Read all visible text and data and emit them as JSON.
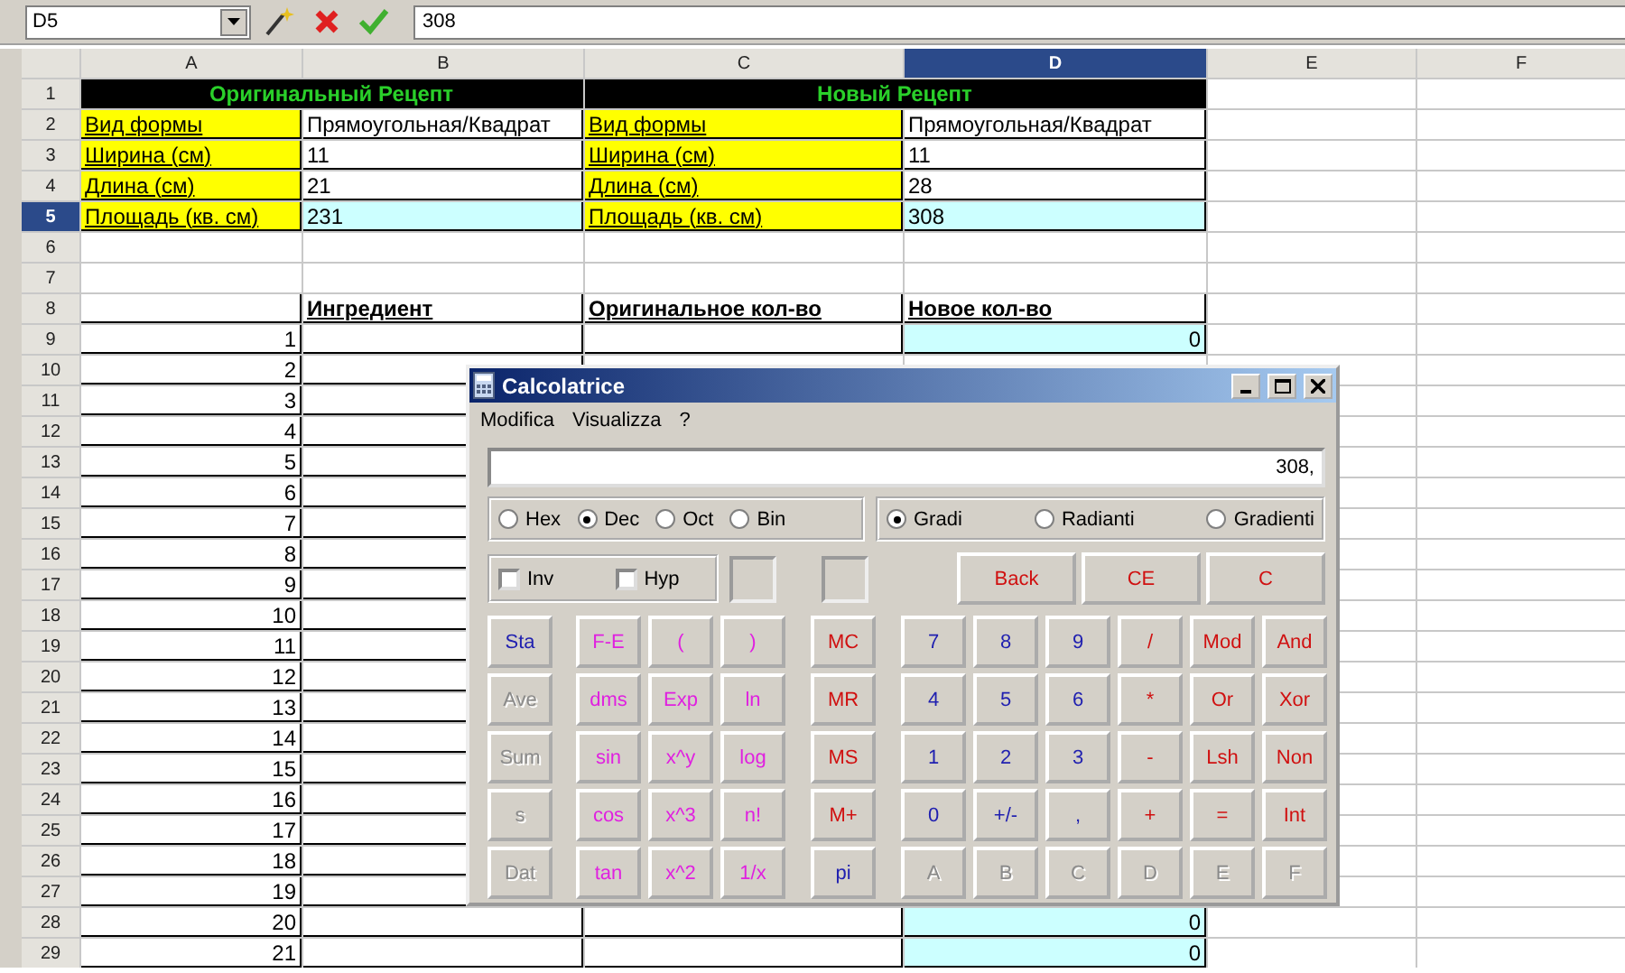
{
  "formula_bar": {
    "cell_reference": "D5",
    "value": "308"
  },
  "sheet": {
    "columns": [
      {
        "label": "A",
        "selected": false
      },
      {
        "label": "B",
        "selected": false
      },
      {
        "label": "C",
        "selected": false
      },
      {
        "label": "D",
        "selected": true
      },
      {
        "label": "E",
        "selected": false
      },
      {
        "label": "F",
        "selected": false
      }
    ],
    "rows": [
      {
        "number": "1",
        "selected": false,
        "cells": [
          {
            "text": "Оригинальный Рецепт",
            "kind": "title"
          },
          {
            "text": "Новый Рецепт",
            "kind": "title"
          }
        ]
      },
      {
        "number": "2",
        "selected": false,
        "cells": [
          {
            "text": "Вид формы",
            "kind": "label"
          },
          {
            "text": "Прямоугольная/Квадрат",
            "kind": "text"
          },
          {
            "text": "Вид формы",
            "kind": "label"
          },
          {
            "text": "Прямоугольная/Квадрат",
            "kind": "text"
          }
        ]
      },
      {
        "number": "3",
        "selected": false,
        "cells": [
          {
            "text": "Ширина (см)",
            "kind": "label"
          },
          {
            "text": "11",
            "kind": "text"
          },
          {
            "text": "Ширина (см)",
            "kind": "label"
          },
          {
            "text": "11",
            "kind": "text"
          }
        ]
      },
      {
        "number": "4",
        "selected": false,
        "cells": [
          {
            "text": "Длина (см)",
            "kind": "label"
          },
          {
            "text": "21",
            "kind": "text"
          },
          {
            "text": "Длина (см)",
            "kind": "label"
          },
          {
            "text": "28",
            "kind": "text"
          }
        ]
      },
      {
        "number": "5",
        "selected": true,
        "cells": [
          {
            "text": "Площадь (кв. см)",
            "kind": "label"
          },
          {
            "text": "231",
            "kind": "result"
          },
          {
            "text": "Площадь (кв. см)",
            "kind": "label"
          },
          {
            "text": "308",
            "kind": "result"
          }
        ]
      },
      {
        "number": "6",
        "selected": false
      },
      {
        "number": "7",
        "selected": false
      },
      {
        "number": "8",
        "selected": false,
        "cells": [
          {
            "kind": "cell"
          },
          {
            "text": "Ингредиент",
            "kind": "heading"
          },
          {
            "text": "Оригинальное кол-во",
            "kind": "heading"
          },
          {
            "text": "Новое кол-во",
            "kind": "heading"
          }
        ]
      },
      {
        "number": "9",
        "selected": false,
        "cells": [
          {
            "text": "1",
            "kind": "number"
          },
          {
            "kind": "cell"
          },
          {
            "kind": "cell"
          },
          {
            "text": "0",
            "kind": "result-number"
          }
        ]
      },
      {
        "number": "10",
        "selected": false,
        "cells": [
          {
            "text": "2",
            "kind": "number"
          },
          {
            "kind": "cell"
          }
        ]
      },
      {
        "number": "11",
        "selected": false,
        "cells": [
          {
            "text": "3",
            "kind": "number"
          },
          {
            "kind": "cell"
          }
        ]
      },
      {
        "number": "12",
        "selected": false,
        "cells": [
          {
            "text": "4",
            "kind": "number"
          },
          {
            "kind": "cell"
          }
        ]
      },
      {
        "number": "13",
        "selected": false,
        "cells": [
          {
            "text": "5",
            "kind": "number"
          },
          {
            "kind": "cell"
          }
        ]
      },
      {
        "number": "14",
        "selected": false,
        "cells": [
          {
            "text": "6",
            "kind": "number"
          },
          {
            "kind": "cell"
          }
        ]
      },
      {
        "number": "15",
        "selected": false,
        "cells": [
          {
            "text": "7",
            "kind": "number"
          },
          {
            "kind": "cell"
          }
        ]
      },
      {
        "number": "16",
        "selected": false,
        "cells": [
          {
            "text": "8",
            "kind": "number"
          },
          {
            "kind": "cell"
          }
        ]
      },
      {
        "number": "17",
        "selected": false,
        "cells": [
          {
            "text": "9",
            "kind": "number"
          },
          {
            "kind": "cell"
          }
        ]
      },
      {
        "number": "18",
        "selected": false,
        "cells": [
          {
            "text": "10",
            "kind": "number"
          },
          {
            "kind": "cell"
          }
        ]
      },
      {
        "number": "19",
        "selected": false,
        "cells": [
          {
            "text": "11",
            "kind": "number"
          },
          {
            "kind": "cell"
          }
        ]
      },
      {
        "number": "20",
        "selected": false,
        "cells": [
          {
            "text": "12",
            "kind": "number"
          },
          {
            "kind": "cell"
          }
        ]
      },
      {
        "number": "21",
        "selected": false,
        "cells": [
          {
            "text": "13",
            "kind": "number"
          },
          {
            "kind": "cell"
          }
        ]
      },
      {
        "number": "22",
        "selected": false,
        "cells": [
          {
            "text": "14",
            "kind": "number"
          },
          {
            "kind": "cell"
          }
        ]
      },
      {
        "number": "23",
        "selected": false,
        "cells": [
          {
            "text": "15",
            "kind": "number"
          },
          {
            "kind": "cell"
          }
        ]
      },
      {
        "number": "24",
        "selected": false,
        "cells": [
          {
            "text": "16",
            "kind": "number"
          },
          {
            "kind": "cell"
          }
        ]
      },
      {
        "number": "25",
        "selected": false,
        "cells": [
          {
            "text": "17",
            "kind": "number"
          },
          {
            "kind": "cell"
          }
        ]
      },
      {
        "number": "26",
        "selected": false,
        "cells": [
          {
            "text": "18",
            "kind": "number"
          },
          {
            "kind": "cell"
          }
        ]
      },
      {
        "number": "27",
        "selected": false,
        "cells": [
          {
            "text": "19",
            "kind": "number"
          },
          {
            "kind": "cell"
          }
        ]
      },
      {
        "number": "28",
        "selected": false,
        "cells": [
          {
            "text": "20",
            "kind": "number"
          },
          {
            "kind": "cell"
          },
          {
            "kind": "cell"
          },
          {
            "text": "0",
            "kind": "result-number"
          }
        ]
      },
      {
        "number": "29",
        "selected": false,
        "cells": [
          {
            "text": "21",
            "kind": "number"
          },
          {
            "kind": "cell"
          },
          {
            "kind": "cell"
          },
          {
            "text": "0",
            "kind": "result-number"
          }
        ]
      }
    ]
  },
  "calculator": {
    "title": "Calcolatrice",
    "menu": [
      "Modifica",
      "Visualizza",
      "?"
    ],
    "display": "308,",
    "number_base": [
      {
        "label": "Hex",
        "selected": false
      },
      {
        "label": "Dec",
        "selected": true
      },
      {
        "label": "Oct",
        "selected": false
      },
      {
        "label": "Bin",
        "selected": false
      }
    ],
    "angle_units": [
      {
        "label": "Gradi",
        "selected": true
      },
      {
        "label": "Radianti",
        "selected": false
      },
      {
        "label": "Gradienti",
        "selected": false
      }
    ],
    "options": [
      {
        "label": "Inv",
        "checked": false
      },
      {
        "label": "Hyp",
        "checked": false
      }
    ],
    "edit_keys": [
      {
        "label": "Back",
        "color": "#d01010"
      },
      {
        "label": "CE",
        "color": "#d01010"
      },
      {
        "label": "C",
        "color": "#d01010"
      }
    ],
    "stat_keys": [
      {
        "label": "Sta",
        "color": "#2020b0"
      },
      {
        "label": "Ave",
        "disabled": true
      },
      {
        "label": "Sum",
        "disabled": true
      },
      {
        "label": "s",
        "disabled": true
      },
      {
        "label": "Dat",
        "disabled": true
      }
    ],
    "function_keys": [
      {
        "label": "F-E",
        "color": "#e020e0"
      },
      {
        "label": "(",
        "color": "#e020e0"
      },
      {
        "label": ")",
        "color": "#e020e0"
      },
      {
        "label": "dms",
        "color": "#e020e0"
      },
      {
        "label": "Exp",
        "color": "#e020e0"
      },
      {
        "label": "ln",
        "color": "#e020e0"
      },
      {
        "label": "sin",
        "color": "#e020e0"
      },
      {
        "label": "x^y",
        "color": "#e020e0"
      },
      {
        "label": "log",
        "color": "#e020e0"
      },
      {
        "label": "cos",
        "color": "#e020e0"
      },
      {
        "label": "x^3",
        "color": "#e020e0"
      },
      {
        "label": "n!",
        "color": "#e020e0"
      },
      {
        "label": "tan",
        "color": "#e020e0"
      },
      {
        "label": "x^2",
        "color": "#e020e0"
      },
      {
        "label": "1/x",
        "color": "#e020e0"
      }
    ],
    "memory_keys": [
      {
        "label": "MC",
        "color": "#d01010"
      },
      {
        "label": "MR",
        "color": "#d01010"
      },
      {
        "label": "MS",
        "color": "#d01010"
      },
      {
        "label": "M+",
        "color": "#d01010"
      },
      {
        "label": "pi",
        "color": "#2020b0"
      }
    ],
    "main_keys": [
      {
        "label": "7",
        "color": "#2020b0"
      },
      {
        "label": "8",
        "color": "#2020b0"
      },
      {
        "label": "9",
        "color": "#2020b0"
      },
      {
        "label": "/",
        "color": "#d01010"
      },
      {
        "label": "Mod",
        "color": "#d01010"
      },
      {
        "label": "And",
        "color": "#d01010"
      },
      {
        "label": "4",
        "color": "#2020b0"
      },
      {
        "label": "5",
        "color": "#2020b0"
      },
      {
        "label": "6",
        "color": "#2020b0"
      },
      {
        "label": "*",
        "color": "#d01010"
      },
      {
        "label": "Or",
        "color": "#d01010"
      },
      {
        "label": "Xor",
        "color": "#d01010"
      },
      {
        "label": "1",
        "color": "#2020b0"
      },
      {
        "label": "2",
        "color": "#2020b0"
      },
      {
        "label": "3",
        "color": "#2020b0"
      },
      {
        "label": "-",
        "color": "#d01010"
      },
      {
        "label": "Lsh",
        "color": "#d01010"
      },
      {
        "label": "Non",
        "color": "#d01010"
      },
      {
        "label": "0",
        "color": "#2020b0"
      },
      {
        "label": "+/-",
        "color": "#2020b0"
      },
      {
        "label": ",",
        "color": "#2020b0"
      },
      {
        "label": "+",
        "color": "#d01010"
      },
      {
        "label": "=",
        "color": "#d01010"
      },
      {
        "label": "Int",
        "color": "#d01010"
      },
      {
        "label": "A",
        "disabled": true
      },
      {
        "label": "B",
        "disabled": true
      },
      {
        "label": "C",
        "disabled": true
      },
      {
        "label": "D",
        "disabled": true
      },
      {
        "label": "E",
        "disabled": true
      },
      {
        "label": "F",
        "disabled": true
      }
    ]
  }
}
